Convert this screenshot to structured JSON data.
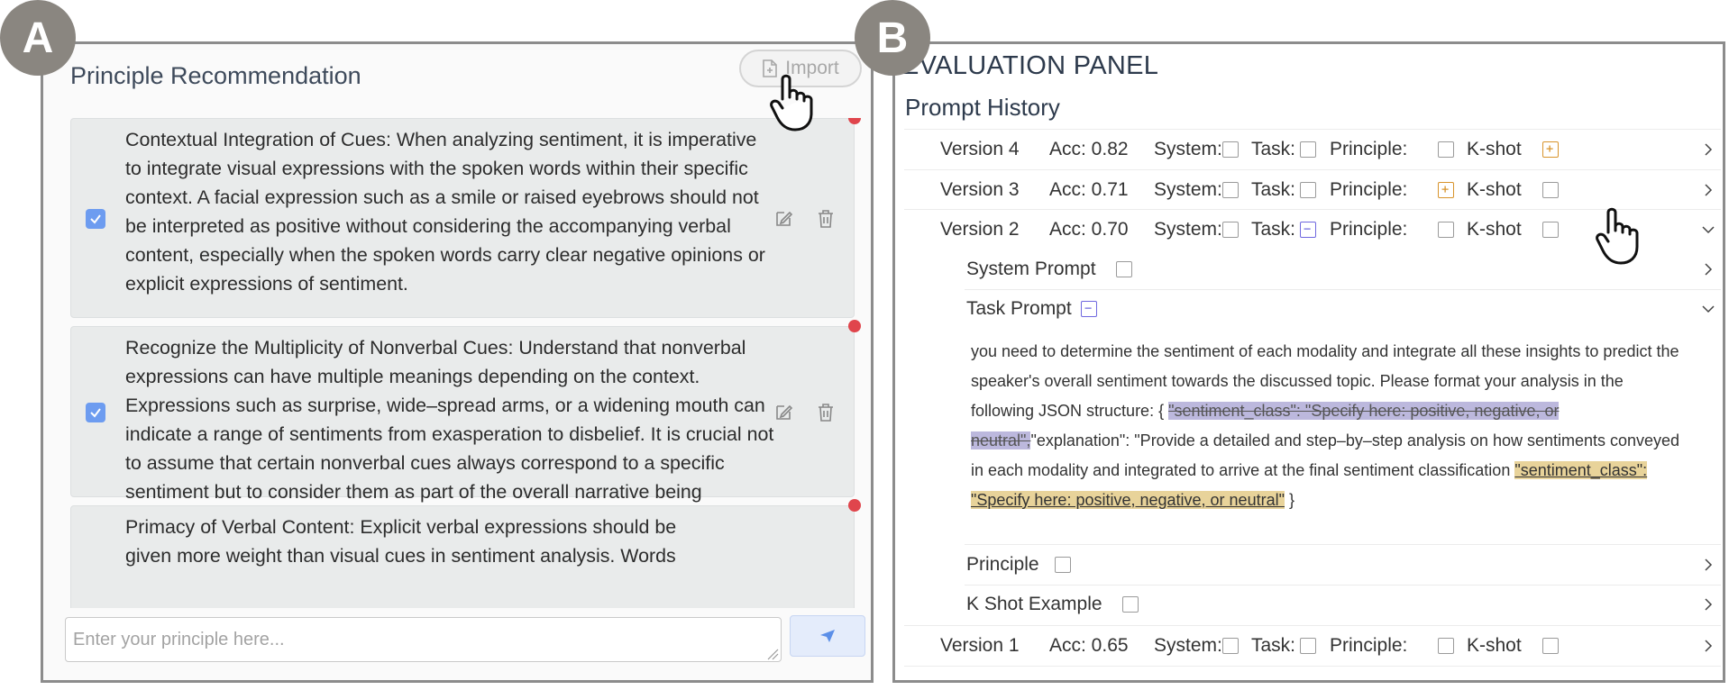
{
  "badges": {
    "a": "A",
    "b": "B"
  },
  "panel_a": {
    "title": "Principle Recommendation",
    "import_label": "Import",
    "cards": [
      {
        "checked": true,
        "text": "Contextual Integration of Cues: When analyzing sentiment, it is imperative to integrate visual expressions with the spoken words within their specific context. A facial expression such as a smile or raised eyebrows should not be interpreted as positive without considering the accompanying verbal content, especially when the spoken words carry clear negative opinions or explicit expressions of sentiment."
      },
      {
        "checked": true,
        "text": "Recognize the Multiplicity of Nonverbal Cues: Understand that nonverbal expressions can have multiple meanings depending on the context. Expressions such as surprise, wide–spread arms, or a widening mouth can indicate a range of sentiments from exasperation to disbelief. It is crucial not to assume that certain nonverbal cues always correspond to a specific sentiment but to consider them as part of the overall narrative being communicated."
      },
      {
        "checked": false,
        "text": "Primacy of Verbal Content: Explicit verbal expressions should be given more weight than visual cues in sentiment analysis. Words"
      }
    ],
    "input_placeholder": "Enter your principle here..."
  },
  "panel_b": {
    "title": "EVALUATION PANEL",
    "subtitle": "Prompt History",
    "labels": {
      "system": "System:",
      "task": "Task:",
      "principle": "Principle:",
      "kshot": "K-shot"
    },
    "versions": [
      {
        "name": "Version 4",
        "acc": "Acc: 0.82",
        "system": "none",
        "task": "none",
        "principle": "none",
        "kshot": "added",
        "expanded": false
      },
      {
        "name": "Version 3",
        "acc": "Acc: 0.71",
        "system": "none",
        "task": "none",
        "principle": "added",
        "kshot": "none",
        "expanded": false
      },
      {
        "name": "Version 2",
        "acc": "Acc: 0.70",
        "system": "none",
        "task": "removed",
        "principle": "none",
        "kshot": "none",
        "expanded": true
      },
      {
        "name": "Version 1",
        "acc": "Acc: 0.65",
        "system": "none",
        "task": "none",
        "principle": "none",
        "kshot": "none",
        "expanded": false
      }
    ],
    "sections": {
      "system_prompt": "System Prompt",
      "task_prompt": "Task Prompt",
      "principle": "Principle",
      "k_shot": "K Shot Example"
    },
    "task_prompt_text": {
      "part1": "you need to determine the sentiment of each modality and integrate all these insights to predict the speaker's overall sentiment towards the discussed topic. Please format your analysis in the following JSON structure: { ",
      "deleted": "\"sentiment_class\": \"Specify here: positive, negative, or neutral\",",
      "part2": "\"explanation\": \"Provide a detailed and step–by–step analysis on how sentiments conveyed in each modality and integrated to arrive at the final sentiment classification ",
      "added": "\"sentiment_class\": \"Specify here: positive, negative, or neutral\"",
      "part3": " }"
    }
  },
  "colors": {
    "checkbox": "#6d9cf0",
    "dot": "#e0454c",
    "added": "#d8942c",
    "removed": "#6f68df",
    "badge": "#8a8680"
  }
}
